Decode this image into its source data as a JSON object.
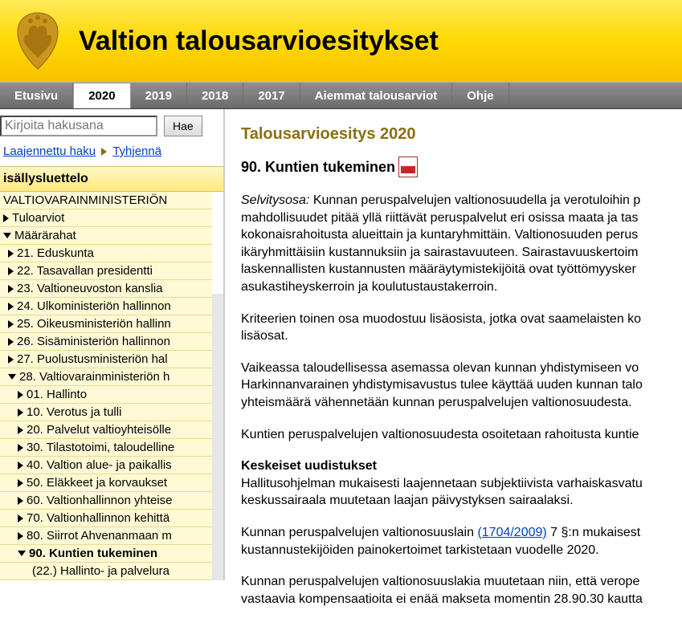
{
  "banner": {
    "title": "Valtion talousarvioesitykset"
  },
  "nav": {
    "items": [
      {
        "label": "Etusivu",
        "active": false
      },
      {
        "label": "2020",
        "active": true
      },
      {
        "label": "2019",
        "active": false
      },
      {
        "label": "2018",
        "active": false
      },
      {
        "label": "2017",
        "active": false
      },
      {
        "label": "Aiemmat talousarviot",
        "active": false
      },
      {
        "label": "Ohje",
        "active": false
      }
    ]
  },
  "search": {
    "placeholder": "Kirjoita hakusana",
    "button": "Hae",
    "advanced_label": "Laajennettu haku",
    "clear_label": "Tyhjennä"
  },
  "toc": {
    "header": "isällysluettelo",
    "items": [
      {
        "label": "VALTIOVARAINMINISTERIÖN",
        "indent": 0,
        "arrow": "none"
      },
      {
        "label": "Tuloarviot",
        "indent": 0,
        "arrow": "right"
      },
      {
        "label": "Määrärahat",
        "indent": 0,
        "arrow": "down"
      },
      {
        "label": "21. Eduskunta",
        "indent": 1,
        "arrow": "right"
      },
      {
        "label": "22. Tasavallan presidentti",
        "indent": 1,
        "arrow": "right"
      },
      {
        "label": "23. Valtioneuvoston kanslia",
        "indent": 1,
        "arrow": "right"
      },
      {
        "label": "24. Ulkoministeriön hallinnon",
        "indent": 1,
        "arrow": "right"
      },
      {
        "label": "25. Oikeusministeriön hallinn",
        "indent": 1,
        "arrow": "right"
      },
      {
        "label": "26. Sisäministeriön hallinnon",
        "indent": 1,
        "arrow": "right"
      },
      {
        "label": "27. Puolustusministeriön hal",
        "indent": 1,
        "arrow": "right"
      },
      {
        "label": "28. Valtiovarainministeriön h",
        "indent": 1,
        "arrow": "down"
      },
      {
        "label": "01. Hallinto",
        "indent": 2,
        "arrow": "right"
      },
      {
        "label": "10. Verotus ja tulli",
        "indent": 2,
        "arrow": "right"
      },
      {
        "label": "20. Palvelut valtioyhteisölle",
        "indent": 2,
        "arrow": "right"
      },
      {
        "label": "30. Tilastotoimi, taloudelline",
        "indent": 2,
        "arrow": "right"
      },
      {
        "label": "40. Valtion alue- ja paikallis",
        "indent": 2,
        "arrow": "right"
      },
      {
        "label": "50. Eläkkeet ja korvaukset",
        "indent": 2,
        "arrow": "right"
      },
      {
        "label": "60. Valtionhallinnon yhteise",
        "indent": 2,
        "arrow": "right"
      },
      {
        "label": "70. Valtionhallinnon kehittä",
        "indent": 2,
        "arrow": "right"
      },
      {
        "label": "80. Siirrot Ahvenanmaan m",
        "indent": 2,
        "arrow": "right"
      },
      {
        "label": "90. Kuntien tukeminen",
        "indent": 2,
        "arrow": "down",
        "selected": true
      },
      {
        "label": "(22.) Hallinto- ja palvelura",
        "indent": 3,
        "arrow": "none"
      }
    ]
  },
  "content": {
    "title": "Talousarvioesitys 2020",
    "heading": "90. Kuntien tukeminen",
    "p1_em": "Selvitysosa:",
    "p1": " Kunnan peruspalvelujen valtionosuudella ja verotuloihin p",
    "p1b": "mahdollisuudet pitää yllä riittävät peruspalvelut eri osissa maata ja tas",
    "p1c": "kokonaisrahoitusta alueittain ja kuntaryhmittäin. Valtionosuuden perus",
    "p1d": "ikäryhmittäisiin kustannuksiin ja sairastavuuteen. Sairastavuuskertoim",
    "p1e": "laskennallisten kustannusten määräytymistekijöitä ovat työttömyysker",
    "p1f": "asukastiheyskerroin ja koulutustaustakerroin.",
    "p2a": "Kriteerien toinen osa muodostuu lisäosista, jotka ovat saamelaisten ko",
    "p2b": "lisäosat.",
    "p3a": "Vaikeassa taloudellisessa asemassa olevan kunnan yhdistymiseen vo",
    "p3b": "Harkinnanvarainen yhdistymisavustus tulee käyttää uuden kunnan talo",
    "p3c": "yhteismäärä vähennetään kunnan peruspalvelujen valtionosuudesta.",
    "p4": "Kuntien peruspalvelujen valtionosuudesta osoitetaan rahoitusta kuntie",
    "p5h": "Keskeiset uudistukset",
    "p5a": "Hallitusohjelman mukaisesti laajennetaan subjektiivista varhaiskasvatu",
    "p5b": "keskussairaala muutetaan laajan päivystyksen sairaalaksi.",
    "p6a": "Kunnan peruspalvelujen valtionosuuslain ",
    "p6_link": "(1704/2009)",
    "p6b": " 7 §:n mukaisest",
    "p6c": "kustannustekijöiden painokertoimet tarkistetaan vuodelle 2020.",
    "p7a": "Kunnan peruspalvelujen valtionosuuslakia muutetaan niin, että verope",
    "p7b": "vastaavia kompensaatioita ei enää makseta momentin 28.90.30 kautta"
  }
}
